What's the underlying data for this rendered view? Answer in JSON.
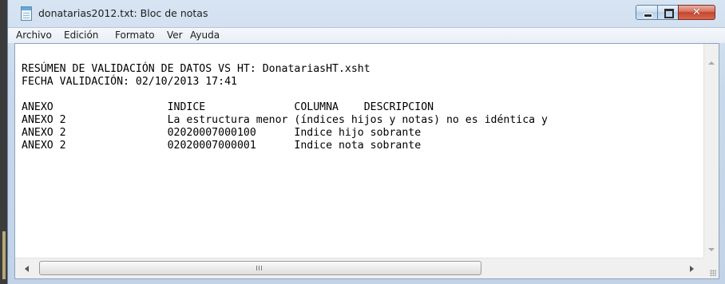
{
  "window": {
    "title": "donatarias2012.txt: Bloc de notas",
    "app_icon": "notepad-icon",
    "controls": {
      "minimize_icon": "minimize-icon",
      "maximize_icon": "maximize-icon",
      "close_glyph": "✕"
    }
  },
  "menu": {
    "items": [
      {
        "label": "Archivo"
      },
      {
        "label": "Edición"
      },
      {
        "label": "Formato"
      },
      {
        "label": "Ver"
      },
      {
        "label": "Ayuda"
      }
    ]
  },
  "document": {
    "lines": [
      "RESÚMEN DE VALIDACIÓN DE DATOS VS HT: DonatariasHT.xsht",
      "FECHA VALIDACIÓN: 02/10/2013 17:41",
      "",
      "ANEXO                  INDICE              COLUMNA    DESCRIPCION",
      "ANEXO 2                La estructura menor (índices hijos y notas) no es idéntica y",
      "ANEXO 2                02020007000100      Indice hijo sobrante",
      "ANEXO 2                02020007000001      Indice nota sobrante"
    ]
  },
  "scrollbars": {
    "horizontal_thumb_grip": "grip-icon"
  },
  "colors": {
    "titlebar": "#c9d9ec",
    "close_button": "#c2452f",
    "text": "#000000"
  }
}
